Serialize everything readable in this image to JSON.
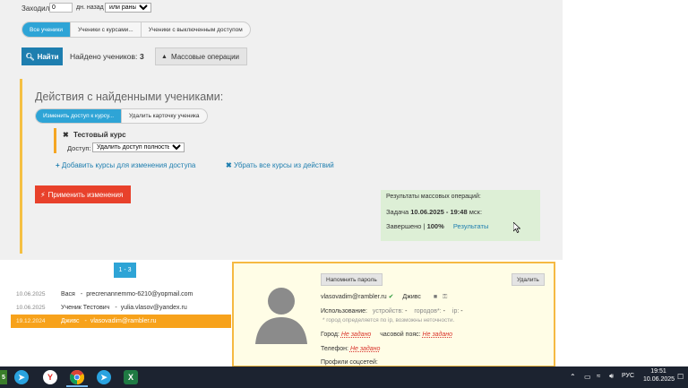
{
  "filter": {
    "visited_label": "Заходили",
    "days_value": "0",
    "days_suffix": "дн. назад",
    "when_select": "или раньше"
  },
  "student_filter_tabs": [
    {
      "label": "Все ученики",
      "active": true
    },
    {
      "label": "Ученики с курсами...",
      "active": false
    },
    {
      "label": "Ученики с выключенным доступом",
      "active": false
    }
  ],
  "search": {
    "find_button": "Найти",
    "found_label": "Найдено учеников:",
    "found_count": "3",
    "bulk_button": "Массовые операции"
  },
  "actions": {
    "title": "Действия с найденными учениками:",
    "tabs": [
      {
        "label": "Изменить доступ к курсу...",
        "active": true
      },
      {
        "label": "Удалить карточку ученика",
        "active": false
      }
    ],
    "course_name": "Тестовый курс",
    "access_label": "Доступ:",
    "access_select": "Удалить доступ полностью",
    "add_courses_link": "Добавить курсы для изменения доступа",
    "remove_courses_link": "Убрать все курсы из действий",
    "apply_button": "Применить изменения"
  },
  "mass_results": {
    "title": "Результаты массовых операций:",
    "task_label": "Задача",
    "task_time": "10.06.2025 - 19:48",
    "task_tz": "мск:",
    "done_label": "Завершено |",
    "done_percent": "100%",
    "results_link": "Результаты"
  },
  "pagination": {
    "label": "1 - 3"
  },
  "students": [
    {
      "date": "10.06.2025",
      "name": "Вася",
      "email": "precrenannemmo-6210@yopmail.com",
      "selected": false
    },
    {
      "date": "10.06.2025",
      "name": "Ученик Тестович",
      "email": "yulia.vlasov@yandex.ru",
      "selected": false
    },
    {
      "date": "19.12.2024",
      "name": "Дживс",
      "email": "vlasovadim@rambler.ru",
      "selected": true
    }
  ],
  "card": {
    "remind_password_button": "Напомнить пароль",
    "delete_button": "Удалить",
    "email": "vlasovadim@rambler.ru",
    "name": "Дживс",
    "usage_label": "Использование:",
    "devices_label": "устройств:",
    "devices_value": "-",
    "cities_label": "городов*:",
    "cities_value": "-",
    "ip_label": "ip:",
    "ip_value": "-",
    "ip_note": "* город определяется по ip, возможны неточности.",
    "city_label": "Город:",
    "city_value": "Не задано",
    "tz_label": "часовой пояс:",
    "tz_value": "Не задано",
    "phone_label": "Телефон:",
    "phone_value": "Не задано",
    "socials_label": "Профили соцсетей:"
  },
  "taskbar": {
    "lang": "РУС",
    "time": "19:51",
    "date": "10.06.2025",
    "apps": [
      {
        "icon": "telegram-icon",
        "color": "#2aa3e0"
      },
      {
        "icon": "yandex-browser-icon",
        "color": "#ffffff"
      },
      {
        "icon": "chrome-icon",
        "color": "#ffffff"
      },
      {
        "icon": "telegram-badge-icon",
        "color": "#2aa3e0"
      },
      {
        "icon": "excel-icon",
        "color": "#1f7a43"
      }
    ]
  },
  "colors": {
    "primary": "#1e7eaf",
    "accent_tab": "#2ea4d6",
    "danger": "#e8412b",
    "highlight_row": "#f7a21b",
    "card_border": "#f5b942",
    "result_bg": "#ddefd6"
  }
}
